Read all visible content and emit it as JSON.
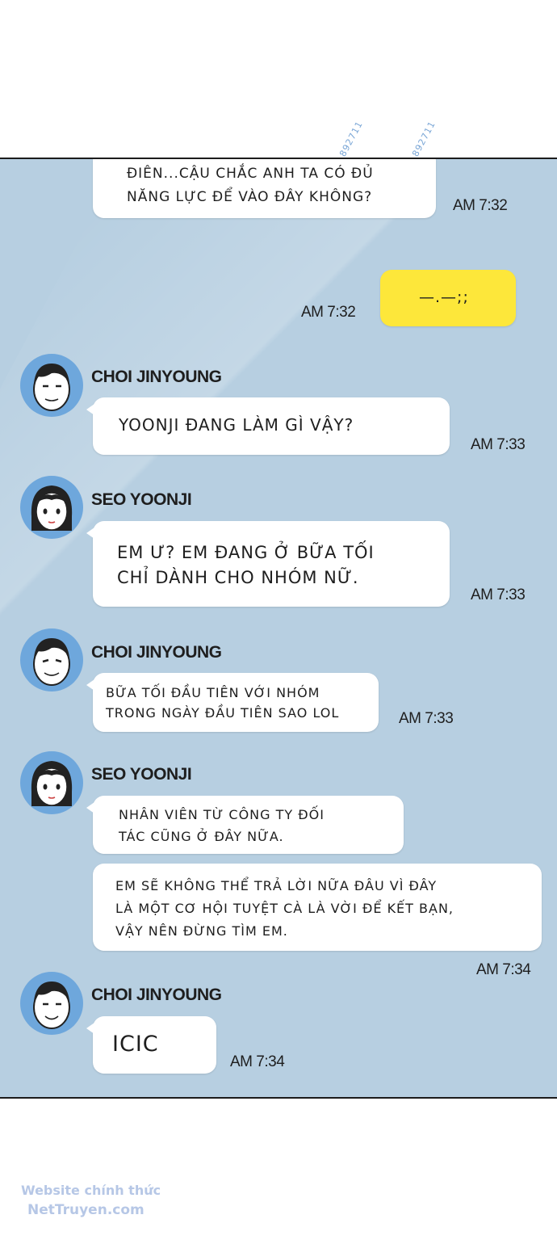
{
  "watermark_ids": [
    "892711",
    "892711"
  ],
  "messages": {
    "m1": {
      "lines": [
        "ĐIÊN...CẬU CHẮC ANH TA CÓ ĐỦ",
        "NĂNG LỰC ĐỂ VÀO ĐÂY KHÔNG?"
      ],
      "time": "AM 7:32"
    },
    "m2": {
      "text": "—.—;;",
      "time": "AM 7:32"
    },
    "m3": {
      "sender": "CHOI JINYOUNG",
      "text": "YOONJI ĐANG LÀM GÌ VẬY?",
      "time": "AM 7:33"
    },
    "m4": {
      "sender": "SEO YOONJI",
      "lines": [
        "EM Ư? EM ĐANG Ở BỮA TỐI",
        "CHỈ DÀNH CHO NHÓM NỮ."
      ],
      "time": "AM 7:33"
    },
    "m5": {
      "sender": "CHOI JINYOUNG",
      "lines": [
        "BỮA TỐI ĐẦU TIÊN VỚI NHÓM",
        "TRONG NGÀY ĐẦU TIÊN SAO LOL"
      ],
      "time": "AM 7:33"
    },
    "m6": {
      "sender": "SEO YOONJI",
      "lines": [
        "NHÂN VIÊN TỪ CÔNG TY ĐỐI",
        "TÁC CŨNG Ở ĐÂY NỮA."
      ]
    },
    "m7": {
      "lines": [
        "EM SẼ KHÔNG THỂ TRẢ LỜI NỮA ĐÂU VÌ ĐÂY",
        "LÀ MỘT CƠ HỘI TUYỆT CÀ LÀ VỜI ĐỂ KẾT BẠN,",
        "VẬY NÊN ĐỪNG TÌM EM."
      ],
      "time": "AM 7:34"
    },
    "m8": {
      "sender": "CHOI JINYOUNG",
      "text": "ICIC",
      "time": "AM 7:34"
    }
  },
  "footer": {
    "line1": "Website chính thức",
    "line2": "NetTruyen.com"
  },
  "colors": {
    "panel_bg": "#b7cfe1",
    "bubble": "#ffffff",
    "my_bubble": "#fde73a",
    "avatar_bg": "#6ea7dc",
    "footer_text": "#b6c7e6"
  }
}
